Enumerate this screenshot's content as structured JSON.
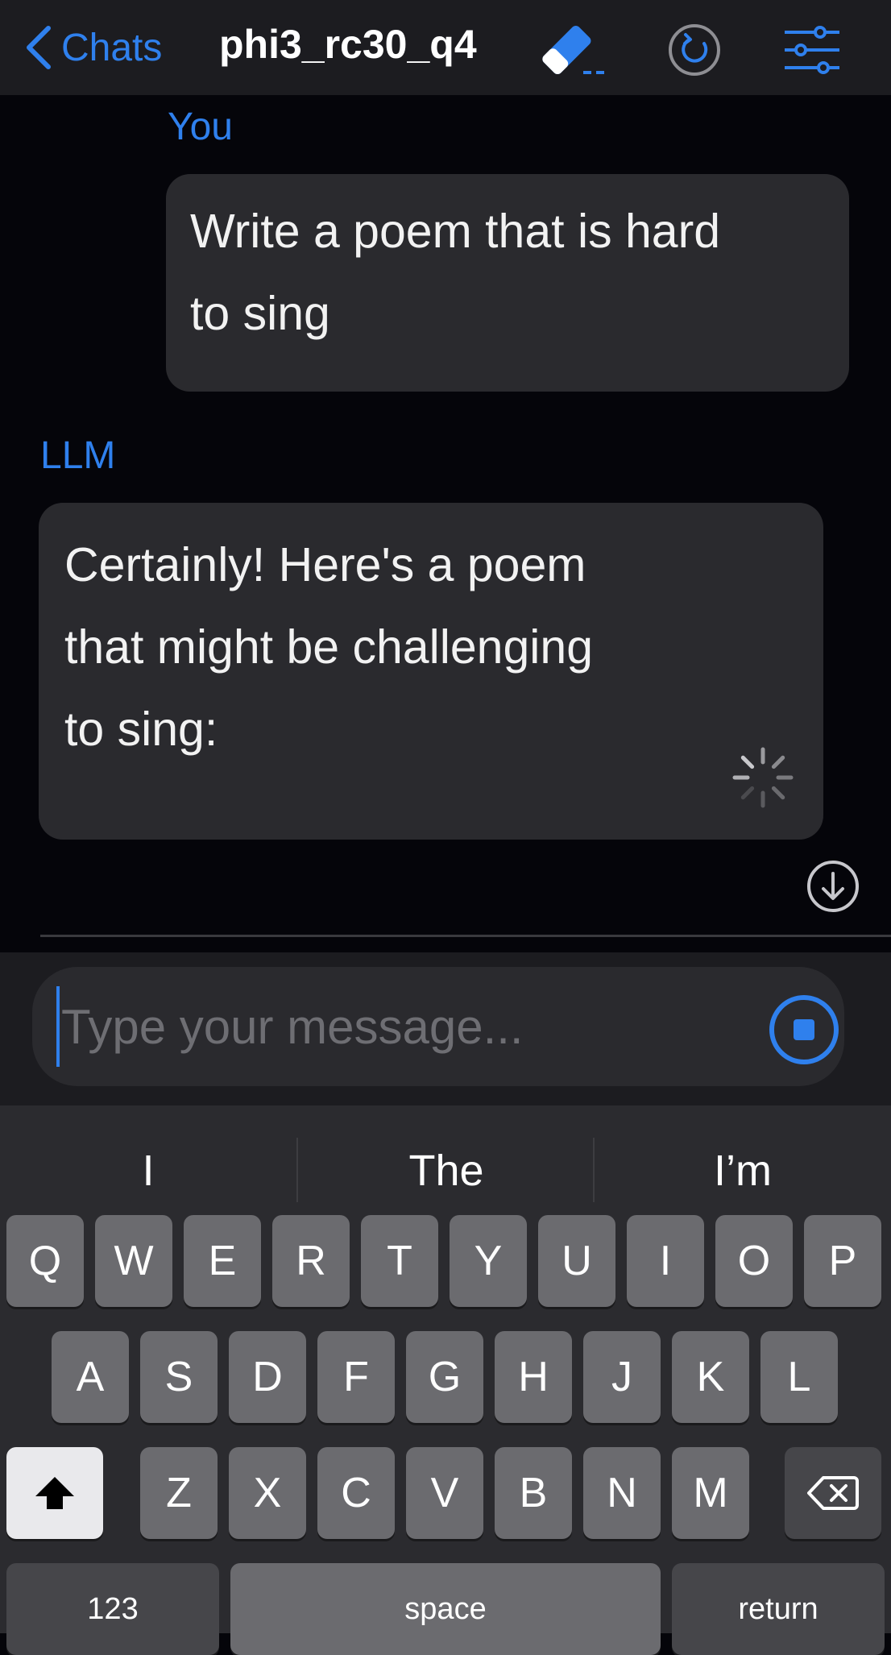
{
  "header": {
    "back_label": "Chats",
    "title": "phi3_rc30_q4",
    "icons": [
      "chevron-left-icon",
      "eraser-icon",
      "restart-icon",
      "settings-sliders-icon"
    ]
  },
  "chat": {
    "messages": [
      {
        "sender": "You",
        "text": "Write a poem that is hard\nto sing"
      },
      {
        "sender": "LLM",
        "text": "Certainly! Here's a poem\nthat might be challenging\nto sing:"
      }
    ]
  },
  "composer": {
    "placeholder": "Type your message...",
    "value": ""
  },
  "keyboard": {
    "suggestions": [
      "I",
      "The",
      "I’m"
    ],
    "row1": [
      "Q",
      "W",
      "E",
      "R",
      "T",
      "Y",
      "U",
      "I",
      "O",
      "P"
    ],
    "row2": [
      "A",
      "S",
      "D",
      "F",
      "G",
      "H",
      "J",
      "K",
      "L"
    ],
    "row3": [
      "Z",
      "X",
      "C",
      "V",
      "B",
      "N",
      "M"
    ],
    "numbers_label": "123",
    "space_label": "space",
    "return_label": "return"
  },
  "colors": {
    "accent": "#2f80ed",
    "background": "#05050a",
    "bubble": "#2a2a2e"
  }
}
